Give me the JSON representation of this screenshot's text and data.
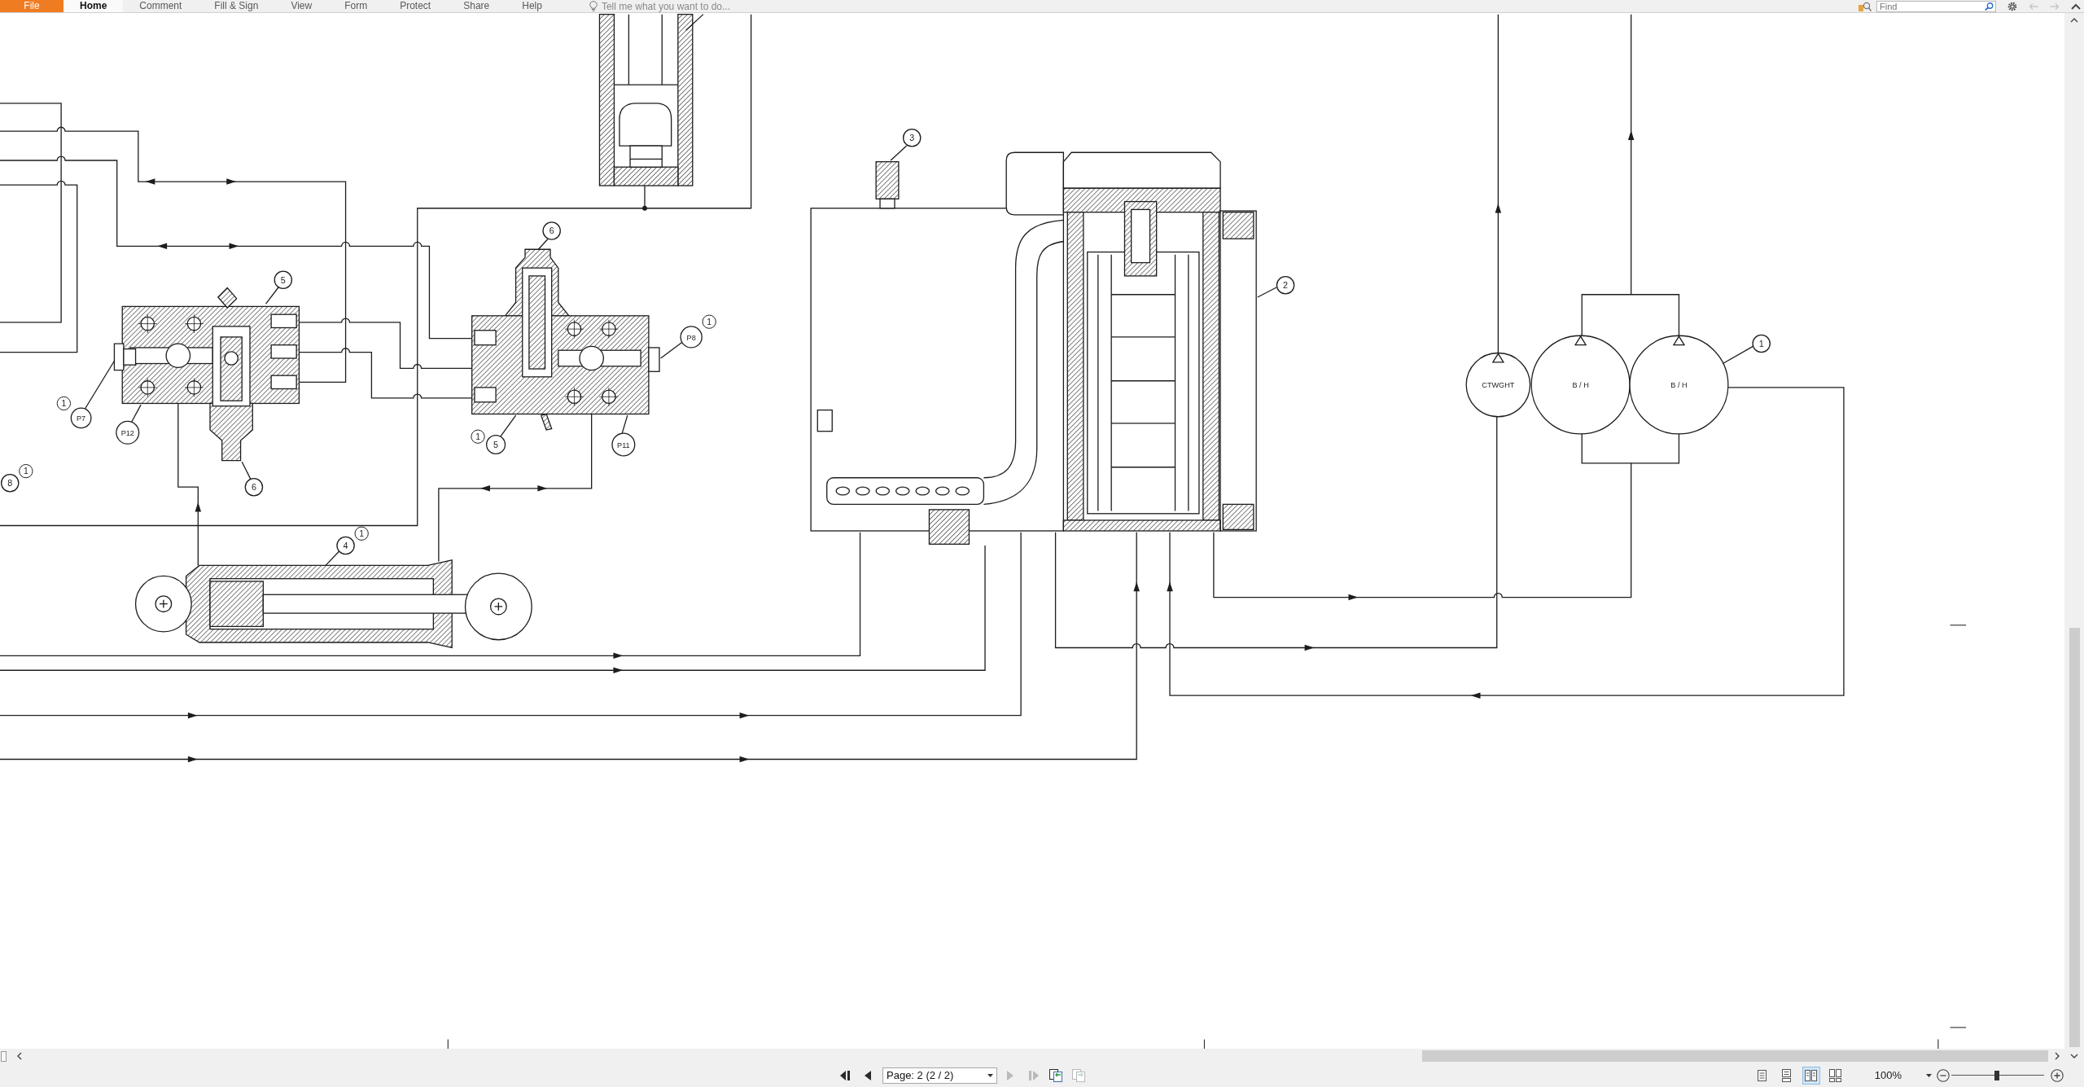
{
  "menu_bar": {
    "tabs": [
      {
        "label": "File",
        "kind": "file",
        "selected": false
      },
      {
        "label": "Home",
        "kind": "tab",
        "selected": true
      },
      {
        "label": "Comment",
        "kind": "tab",
        "selected": false
      },
      {
        "label": "Fill & Sign",
        "kind": "tab",
        "selected": false
      },
      {
        "label": "View",
        "kind": "tab",
        "selected": false
      },
      {
        "label": "Form",
        "kind": "tab",
        "selected": false
      },
      {
        "label": "Protect",
        "kind": "tab",
        "selected": false
      },
      {
        "label": "Share",
        "kind": "tab",
        "selected": false
      },
      {
        "label": "Help",
        "kind": "tab",
        "selected": false
      }
    ],
    "tell_me": {
      "placeholder": "Tell me what you want to do..."
    },
    "find": {
      "placeholder": "Find"
    },
    "tool_icons": [
      {
        "kind": "options",
        "disabled": false
      },
      {
        "kind": "back",
        "disabled": true
      },
      {
        "kind": "forward",
        "disabled": true
      },
      {
        "kind": "collapse",
        "disabled": false
      }
    ]
  },
  "drawing": {
    "callouts": [
      {
        "number": "3"
      },
      {
        "number": "6"
      },
      {
        "number": "5"
      },
      {
        "number": "2"
      },
      {
        "number": "P8",
        "revision_mark": "1"
      },
      {
        "number": "1"
      },
      {
        "number": "P7",
        "revision_mark": "1"
      },
      {
        "number": "P12"
      },
      {
        "number": "5",
        "revision_mark": "1"
      },
      {
        "number": "P11"
      },
      {
        "number": "8",
        "revision_mark": "1"
      },
      {
        "number": "6"
      },
      {
        "number": "4",
        "revision_mark": "1"
      }
    ],
    "motor_labels": [
      "CTWGHT",
      "B / H",
      "B / H"
    ]
  },
  "status_bar": {
    "page_nav": {
      "back_buttons": [
        {
          "kind": "first",
          "disabled": false
        },
        {
          "kind": "previous",
          "disabled": false
        }
      ],
      "page_field": {
        "value": "Page: 2 (2 / 2)"
      },
      "forward_buttons": [
        {
          "kind": "next",
          "disabled": true
        },
        {
          "kind": "last",
          "disabled": true
        },
        {
          "kind": "previous_view",
          "disabled": false
        },
        {
          "kind": "next_view",
          "disabled": true
        }
      ]
    },
    "view_buttons": [
      {
        "kind": "single",
        "selected": false
      },
      {
        "kind": "continuous",
        "selected": false
      },
      {
        "kind": "facing",
        "selected": true
      },
      {
        "kind": "continuous_facing",
        "selected": false
      }
    ],
    "zoom": {
      "value": "100%",
      "level": 0.49
    }
  }
}
